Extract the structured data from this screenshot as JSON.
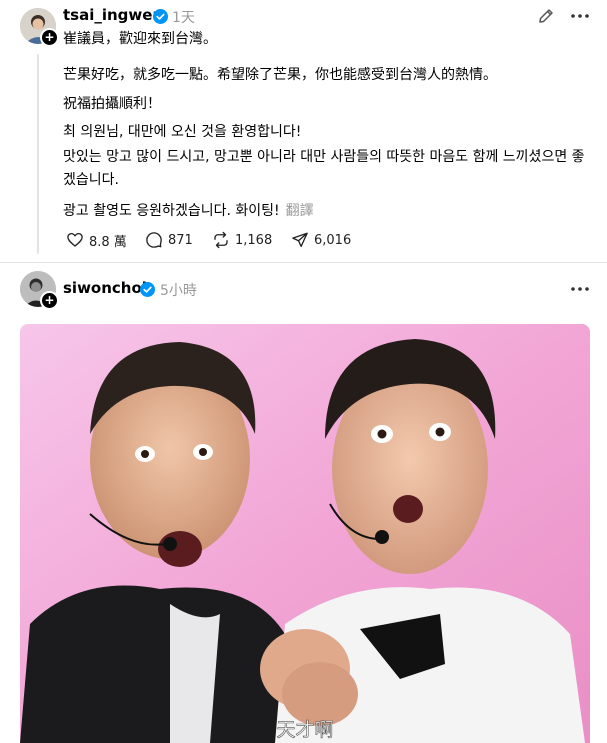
{
  "post1": {
    "username": "tsai_ingwen",
    "time": "1天",
    "lines": [
      "崔議員，歡迎來到台灣。",
      "芒果好吃，就多吃一點。希望除了芒果，你也能感受到台灣人的熱情。",
      "祝福拍攝順利！",
      "최 의원님, 대만에 오신 것을 환영합니다!",
      "맛있는 망고 많이 드시고, 망고뿐 아니라 대만 사람들의 따뜻한 마음도 함께 느끼셨으면 좋겠습니다.",
      "광고 촬영도 응원하겠습니다. 화이팅!"
    ],
    "translate_label": "翻譯",
    "stats": {
      "likes": "8.8 萬",
      "replies": "871",
      "reposts": "1,168",
      "shares": "6,016"
    }
  },
  "post2": {
    "username": "siwonchoi",
    "time": "5小時",
    "caption": "天才啊"
  },
  "icons": {
    "verified": "verified-badge-icon",
    "edit": "pencil-icon",
    "more": "more-dots-icon",
    "like": "heart-icon",
    "reply": "comment-icon",
    "repost": "repost-icon",
    "share": "send-icon",
    "follow": "plus-icon"
  },
  "colors": {
    "verified": "#0095f6",
    "muted": "#999999",
    "photo_bg": "#f2a8d8"
  }
}
